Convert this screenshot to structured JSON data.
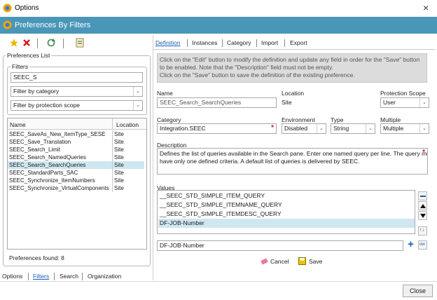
{
  "window": {
    "title": "Options",
    "close_glyph": "×"
  },
  "header": {
    "title": "Preferences By Filters"
  },
  "toolbar": {
    "icons": [
      "new-star-icon",
      "delete-x-icon",
      "refresh-icon",
      "export-icon"
    ]
  },
  "left": {
    "group_title": "Preferences List",
    "filters_title": "Filters",
    "filter_value": "SEEC_S",
    "category_select": "Filter by category",
    "scope_select": "Filter by protection scope",
    "columns": [
      "Name",
      "Location"
    ],
    "rows": [
      {
        "name": "SEEC_SaveAs_New_ItemType_SESE",
        "location": "Site"
      },
      {
        "name": "SEEC_Save_Translation",
        "location": "Site"
      },
      {
        "name": "SEEC_Search_Limit",
        "location": "Site"
      },
      {
        "name": "SEEC_Search_NamedQueries",
        "location": "Site"
      },
      {
        "name": "SEEC_Search_SearchQueries",
        "location": "Site"
      },
      {
        "name": "SEEC_StandardParts_SAC",
        "location": "Site"
      },
      {
        "name": "SEEC_Synchronize_ItemNumbers",
        "location": "Site"
      },
      {
        "name": "SEEC_Synchronize_VirtualComponents",
        "location": "Site"
      }
    ],
    "selected_index": 4,
    "found_text": "Preferences found: 8"
  },
  "bottom_tabs": [
    "Options",
    "Filters",
    "Search",
    "Organization"
  ],
  "right_tabs": [
    "Definition",
    "Instances",
    "Category",
    "Import",
    "Export"
  ],
  "info": {
    "line1": "Click on the \"Edit\" button to modify the definition and update any field in order for the \"Save\" button",
    "line2": "to be enabled. Note that the \"Description\" field must not be empty.",
    "line3": "Click on the \"Save\" button to save the definition of the existing preference."
  },
  "form": {
    "name_label": "Name",
    "name_value": "SEEC_Search_SearchQueries",
    "location_label": "Location",
    "location_value": "Site",
    "protection_label": "Protection Scope",
    "protection_value": "User",
    "category_label": "Category",
    "category_value": "Integration.SEEC",
    "environment_label": "Environment",
    "environment_value": "Disabled",
    "type_label": "Type",
    "type_value": "String",
    "multiple_label": "Multiple",
    "multiple_value": "Multiple",
    "description_label": "Description",
    "description_line1": "Defines the list of queries available in the Search pane. Enter one named query per line. The query must",
    "description_line2": "have only one defined criteria. A default list of queries is delivered by SEEC.",
    "values_label": "Values",
    "values": [
      "__SEEC_STD_SIMPLE_ITEM_QUERY",
      "__SEEC_STD_SIMPLE_ITEMNAME_QUERY",
      "__SEEC_STD_SIMPLE_ITEMDESC_QUERY",
      "DF-JOB-Number"
    ],
    "selected_value_index": 3,
    "new_value": "DF-JOB-Number",
    "required_mark": "*"
  },
  "actions": {
    "cancel": "Cancel",
    "save": "Save",
    "close": "Close"
  },
  "colors": {
    "header": "#4a96b8",
    "selected_row": "#cfe7f1",
    "accent_red": "#d01818"
  }
}
